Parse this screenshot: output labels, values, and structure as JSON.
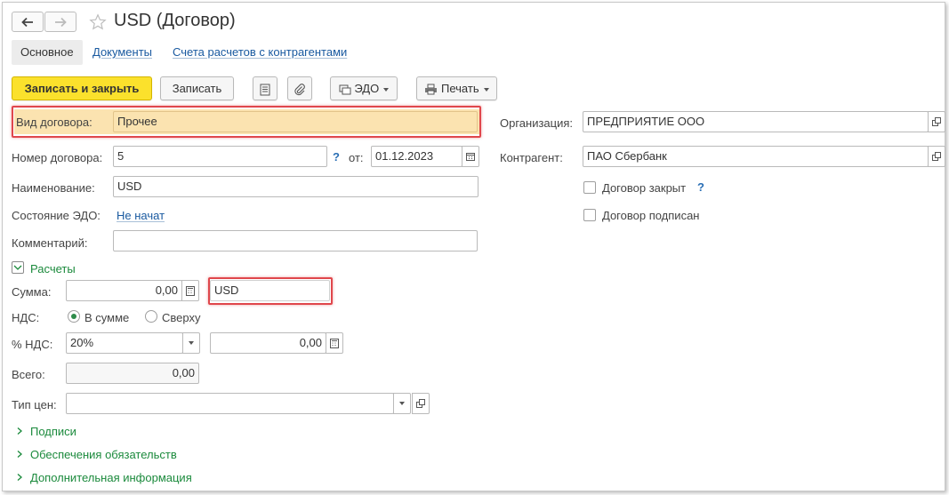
{
  "header": {
    "title": "USD (Договор)",
    "back_icon": "arrow-left-icon",
    "forward_icon": "arrow-right-icon",
    "favorite_icon": "star-icon"
  },
  "tabs": [
    {
      "label": "Основное"
    },
    {
      "label": "Документы"
    },
    {
      "label": "Счета расчетов с контрагентами"
    }
  ],
  "toolbar": {
    "save_close_label": "Записать и закрыть",
    "save_label": "Записать",
    "edo_label": "ЭДО",
    "print_label": "Печать"
  },
  "form": {
    "contract_type": {
      "label": "Вид договора:",
      "value": "Прочее"
    },
    "contract_number": {
      "label": "Номер договора:",
      "value": "5",
      "help": "?",
      "date_label": "от:",
      "date_value": "01.12.2023"
    },
    "name": {
      "label": "Наименование:",
      "value": "USD"
    },
    "edo_state": {
      "label": "Состояние ЭДО:",
      "value": "Не начат"
    },
    "comment": {
      "label": "Комментарий:",
      "value": ""
    },
    "organization": {
      "label": "Организация:",
      "value": "ПРЕДПРИЯТИЕ ООО"
    },
    "counterparty": {
      "label": "Контрагент:",
      "value": "ПАО Сбербанк"
    },
    "contract_closed": {
      "label": "Договор закрыт",
      "checked": false,
      "help": "?"
    },
    "contract_signed": {
      "label": "Договор подписан",
      "checked": false
    }
  },
  "settlements": {
    "section_label": "Расчеты",
    "sum_label": "Сумма:",
    "sum_value": "0,00",
    "currency_value": "USD",
    "vat_label": "НДС:",
    "vat_option_in_sum": "В сумме",
    "vat_option_on_top": "Сверху",
    "vat_selected": "В сумме",
    "vat_rate_label": "% НДС:",
    "vat_rate_value": "20%",
    "vat_amount_value": "0,00",
    "total_label": "Всего:",
    "total_value": "0,00",
    "price_type_label": "Тип цен:",
    "price_type_value": ""
  },
  "collapsed_sections": [
    {
      "label": "Подписи"
    },
    {
      "label": "Обеспечения обязательств"
    },
    {
      "label": "Дополнительная информация"
    }
  ],
  "colors": {
    "primary_button": "#fbe12c",
    "highlight_field": "#fbe3b0",
    "annotation_border": "#e0474c",
    "link": "#1a5aa0",
    "section_green": "#1b8a3c"
  }
}
